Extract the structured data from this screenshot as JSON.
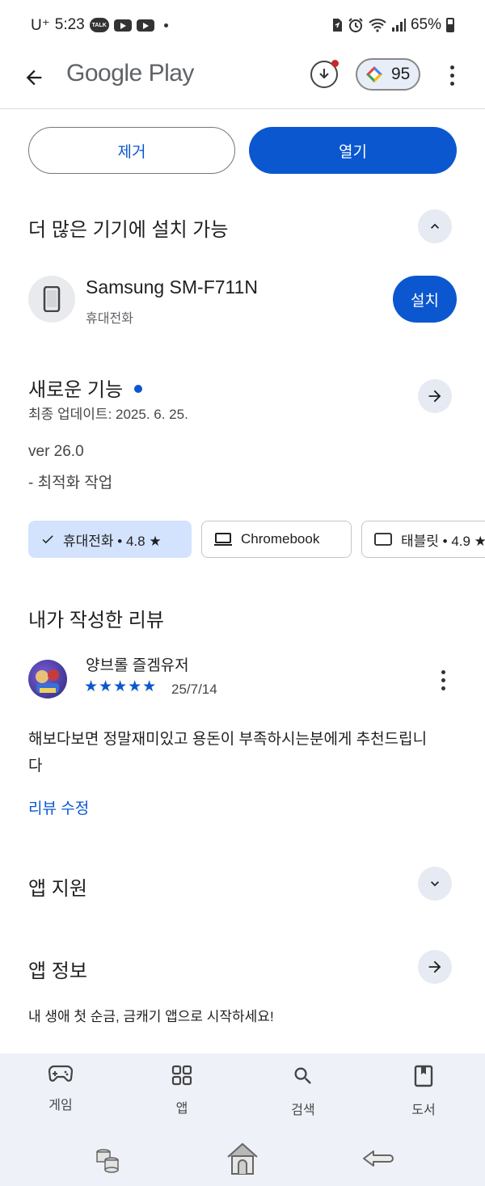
{
  "status_bar": {
    "carrier": "U⁺",
    "time": "5:23",
    "battery_pct": "65%",
    "talk_badge": "TALK"
  },
  "app_bar": {
    "title": "Google Play",
    "points": "95"
  },
  "actions": {
    "remove_label": "제거",
    "open_label": "열기"
  },
  "install_more": {
    "title": "더 많은 기기에 설치 가능",
    "device_name": "Samsung SM-F711N",
    "device_type": "휴대전화",
    "install_label": "설치"
  },
  "whats_new": {
    "title": "새로운 기능",
    "last_updated": "최종 업데이트: 2025. 6. 25.",
    "version": "ver 26.0",
    "notes": "- 최적화 작업"
  },
  "device_chips": [
    {
      "label": "휴대전화 • 4.8 ★",
      "selected": true
    },
    {
      "label": "Chromebook",
      "selected": false
    },
    {
      "label": "태블릿 • 4.9 ★",
      "selected": false
    }
  ],
  "my_review": {
    "title": "내가 작성한 리뷰",
    "reviewer": "양브롤 즐겜유저",
    "stars": "★★★★★",
    "rating": 5,
    "date": "25/7/14",
    "text": "해보다보면 정말재미있고 용돈이 부족하시는분에게 추천드립니다",
    "edit_label": "리뷰 수정"
  },
  "app_support": {
    "title": "앱 지원"
  },
  "app_info": {
    "title": "앱 정보",
    "description": "내 생애 첫 순금, 금캐기 앱으로 시작하세요!"
  },
  "bottom_nav": {
    "games": "게임",
    "apps": "앱",
    "search": "검색",
    "books": "도서"
  },
  "colors": {
    "primary": "#0b57d0",
    "chip_selected": "#d3e3fd",
    "nav_bg": "#eef2f8"
  }
}
